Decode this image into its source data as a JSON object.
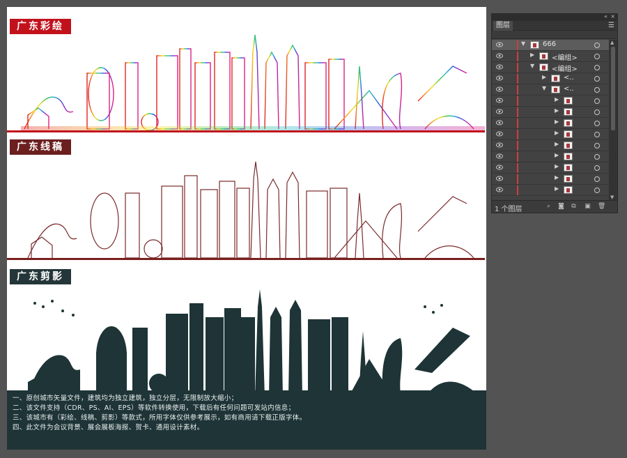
{
  "artboard": {
    "sections": [
      {
        "title": "广东彩绘"
      },
      {
        "title": "广东线稿"
      },
      {
        "title": "广东剪影"
      }
    ],
    "notes": [
      "一、原创城市矢量文件，建筑均为独立建筑，独立分层，无限制放大缩小；",
      "二、该文件支持（CDR、PS、AI、EPS）等软件转换使用，下载后有任何问题可发站内信息；",
      "三、该城市有（彩绘、线稿、剪影）等款式，所用字体仅供参考展示，如有商用请下载正版字体。",
      "四、此文件为会议背景、展会展板海报、贺卡、通用设计素材。"
    ],
    "colors": {
      "tag_color": "#c1121c",
      "tag_line": "#6b1f1f",
      "tag_silhouette": "#243639",
      "line_stroke": "#7a2a2a",
      "silhouette_fill": "#1e3436"
    }
  },
  "layers_panel": {
    "tab_label": "图层",
    "top_layer_name": "666",
    "group_label": "<编组>",
    "sub_label": "<..",
    "layer_count": "1 个图层",
    "icons": {
      "eye": "eye-icon",
      "collapse": "double-chevron-icon",
      "close": "close-icon",
      "menu": "hamburger-menu-icon",
      "locate": "search-icon",
      "clip": "clipping-mask-icon",
      "new_sublayer": "new-sublayer-icon",
      "new_layer": "new-layer-icon",
      "delete": "trash-icon"
    }
  }
}
